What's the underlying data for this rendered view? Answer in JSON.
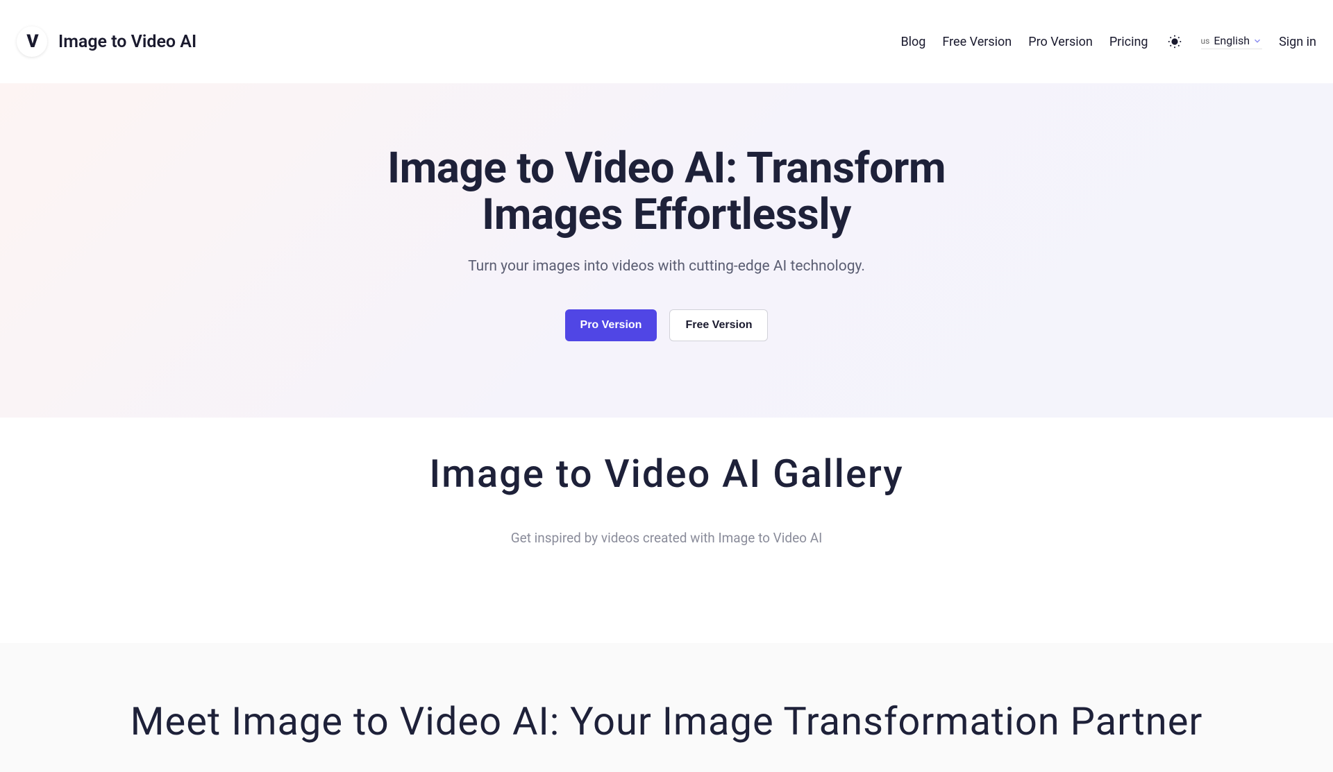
{
  "header": {
    "brand": "Image to Video AI",
    "nav": {
      "blog": "Blog",
      "free": "Free Version",
      "pro": "Pro Version",
      "pricing": "Pricing"
    },
    "language": {
      "prefix": "us",
      "label": "English"
    },
    "signin": "Sign in"
  },
  "hero": {
    "title": "Image to Video AI: Transform Images Effortlessly",
    "subtitle": "Turn your images into videos with cutting-edge AI technology.",
    "cta_primary": "Pro Version",
    "cta_secondary": "Free Version"
  },
  "gallery": {
    "title": "Image to Video AI Gallery",
    "subtitle": "Get inspired by videos created with Image to Video AI"
  },
  "partner": {
    "title": "Meet Image to Video AI: Your Image Transformation Partner"
  },
  "colors": {
    "accent": "#5046e5",
    "text_primary": "#1e2139",
    "text_muted": "#8a8c9a"
  }
}
